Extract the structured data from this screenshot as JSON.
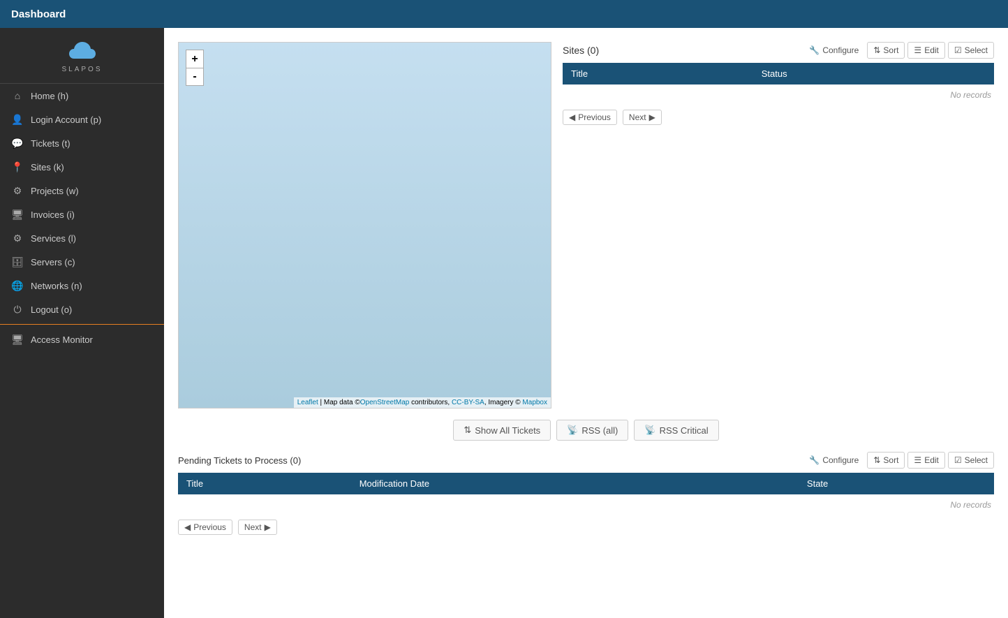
{
  "topbar": {
    "title": "Dashboard"
  },
  "sidebar": {
    "nav_items": [
      {
        "id": "home",
        "label": "Home (h)",
        "icon": "⌂"
      },
      {
        "id": "login-account",
        "label": "Login Account (p)",
        "icon": "👤"
      },
      {
        "id": "tickets",
        "label": "Tickets (t)",
        "icon": "💬"
      },
      {
        "id": "sites",
        "label": "Sites (k)",
        "icon": "📍"
      },
      {
        "id": "projects",
        "label": "Projects (w)",
        "icon": "⚙"
      },
      {
        "id": "invoices",
        "label": "Invoices (i)",
        "icon": "🖥"
      },
      {
        "id": "services",
        "label": "Services (l)",
        "icon": "⚙"
      },
      {
        "id": "servers",
        "label": "Servers (c)",
        "icon": "🗄"
      },
      {
        "id": "networks",
        "label": "Networks (n)",
        "icon": "🌐"
      },
      {
        "id": "logout",
        "label": "Logout (o)",
        "icon": "⏻"
      }
    ],
    "access_monitor_label": "Access Monitor"
  },
  "map": {
    "zoom_in_label": "+",
    "zoom_out_label": "-",
    "attribution_leaflet": "Leaflet",
    "attribution_text": " | Map data ©",
    "attribution_osm": "OpenStreetMap",
    "attribution_text2": " contributors, ",
    "attribution_cc": "CC-BY-SA",
    "attribution_text3": ", Imagery © ",
    "attribution_mapbox": "Mapbox"
  },
  "sites_panel": {
    "title": "Sites (0)",
    "configure_label": "Configure",
    "sort_label": "Sort",
    "edit_label": "Edit",
    "select_label": "Select",
    "col_title": "Title",
    "col_status": "Status",
    "no_records": "No records",
    "prev_label": "Previous",
    "next_label": "Next"
  },
  "ticket_buttons": {
    "show_all": "Show All Tickets",
    "rss_all": "RSS (all)",
    "rss_critical": "RSS Critical"
  },
  "pending_tickets": {
    "title": "Pending Tickets to Process (0)",
    "configure_label": "Configure",
    "sort_label": "Sort",
    "edit_label": "Edit",
    "select_label": "Select",
    "col_title": "Title",
    "col_modification_date": "Modification Date",
    "col_state": "State",
    "no_records": "No records",
    "prev_label": "Previous",
    "next_label": "Next"
  }
}
